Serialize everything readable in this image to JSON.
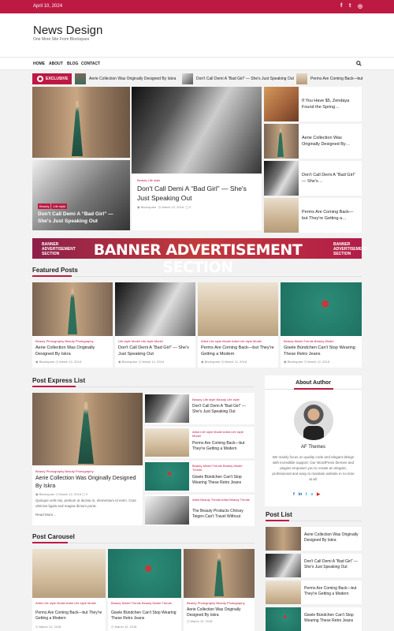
{
  "topbar": {
    "date": "April 10, 2024",
    "social_icons": [
      "facebook-icon",
      "twitter-icon",
      "instagram-icon"
    ]
  },
  "header": {
    "title": "News Design",
    "tagline": "One More Site From Blockspare"
  },
  "nav": {
    "items": [
      "HOME",
      "ABOUT",
      "BLOG",
      "CONTACT"
    ],
    "search_icon": "search-icon"
  },
  "ticker": {
    "label": "EXCLUSIVE",
    "items": [
      "Aerie Collection Was Originally Designed By Iskra",
      "Don't Call Demi A “Bad Girl” — She's Just Speaking Out",
      "Perms Are Coming Back—but"
    ]
  },
  "hero": {
    "left_bottom": {
      "cats": [
        "Beauty",
        "Life style"
      ],
      "title": "Don't Call Demi A “Bad Girl” — She's Just Speaking Out"
    },
    "center": {
      "cats": "Beauty  Life style",
      "title": "Don't Call Demi A “Bad Girl” — She's Just Speaking Out",
      "author": "Blockspare",
      "date": "March 12, 2018",
      "comments": "0"
    },
    "right_list": [
      "If You Have $5, Zendaya Found the Spring…",
      "Aerie Collection Was Originally Designed By…",
      "Don't Call Demi A “Bad Girl” — She's…",
      "Perms Are Coming Back—but They're Getting a…"
    ]
  },
  "banner": {
    "text": "BANNER ADVERTISEMENT SECTION",
    "small_left": [
      "BANNER",
      "ADVERTISEMENT",
      "SECTION"
    ],
    "small_right": [
      "BANNER",
      "ADVERTISEMENT",
      "SECTION"
    ]
  },
  "featured": {
    "heading": "Featured Posts",
    "posts": [
      {
        "cats": "Beauty  Photography  Beauty  Photography",
        "title": "Aerie Collection Was Originally Designed By Iskra",
        "author": "Blockspare",
        "date": "March 12, 2018"
      },
      {
        "cats": "Life style  Model  Life style  Model",
        "title": "Don't Call Demi A “Bad Girl” — She's Just Speaking Out",
        "author": "Blockspare",
        "date": "March 12, 2018"
      },
      {
        "cats": "Artist  Life style  Model  Artist  Life style  Model",
        "title": "Perms Are Coming Back—but They're Getting a Modern",
        "author": "Blockspare",
        "date": "March 12, 2018"
      },
      {
        "cats": "Beauty  Model  Trends  Beauty  Model",
        "title": "Gisele Bündchen Can't Stop Wearing These Retro Jeans",
        "author": "Blockspare",
        "date": "March 12, 2018"
      }
    ]
  },
  "express": {
    "heading": "Post Express List",
    "main": {
      "cats": "Beauty  Photography  Beauty  Photography",
      "title": "Aerie Collection Was Originally Designed By Iskra",
      "author": "Blockspare",
      "date": "March 12, 2018",
      "comments": "0",
      "excerpt": "Quisque velit nisi, pretium ut lacinia in, elementum id enim. Cras ultricies ligula sed magna dictum porta.",
      "read_more": "Read More..."
    },
    "list": [
      {
        "cats": "Beauty  Life style  Beauty  Life style",
        "title": "Don't Call Demi A “Bad Girl” — She's Just Speaking Out"
      },
      {
        "cats": "Artist  Life style  Model  Artist  Life style  Model",
        "title": "Perms Are Coming Back—but They're Getting a Modern"
      },
      {
        "cats": "Beauty  Model  Trends  Beauty  Model  Trends",
        "title": "Gisele Bündchen Can't Stop Wearing These Retro Jeans"
      },
      {
        "cats": "Artist  Beauty  Trends  Artist  Beauty  Trends",
        "title": "The Beauty Products Chrissy Teigen Can't Travel Without"
      }
    ]
  },
  "about": {
    "heading": "About Author",
    "name": "AF Themes",
    "bio": "We mainly focus on quality code and elegant design with incredible support. Our WordPress themes and plugins empower you to create an elegant, professional and easy to maintain website in no time at all.",
    "social_icons": [
      "facebook-icon",
      "linkedin-icon",
      "twitter-icon",
      "vimeo-icon",
      "youtube-icon"
    ]
  },
  "post_list": {
    "heading": "Post List",
    "items": [
      "Aerie Collection Was Originally Designed By Iskra",
      "Don't Call Demi A “Bad Girl” — She's Just Speaking Out",
      "Perms Are Coming Back—but They're Getting a Modern",
      "Gisele Bündchen Can't Stop Wearing These Retro Jeans"
    ]
  },
  "carousel": {
    "heading": "Post Carousel",
    "posts": [
      {
        "cats": "Artist  Life style  Model  Artist  Life style  Model",
        "title": "Perms Are Coming Back—but They're Getting a Modern",
        "date": "March 12, 2018"
      },
      {
        "cats": "Beauty  Model  Trends  Beauty  Model  Trends",
        "title": "Gisele Bündchen Can't Stop Wearing These Retro Jeans",
        "date": "March 12, 2018"
      },
      {
        "cats": "Beauty  Photography  Beauty  Photography",
        "title": "Aerie Collection Was Originally Designed By Iskra",
        "date": "March 12, 2018"
      }
    ]
  }
}
